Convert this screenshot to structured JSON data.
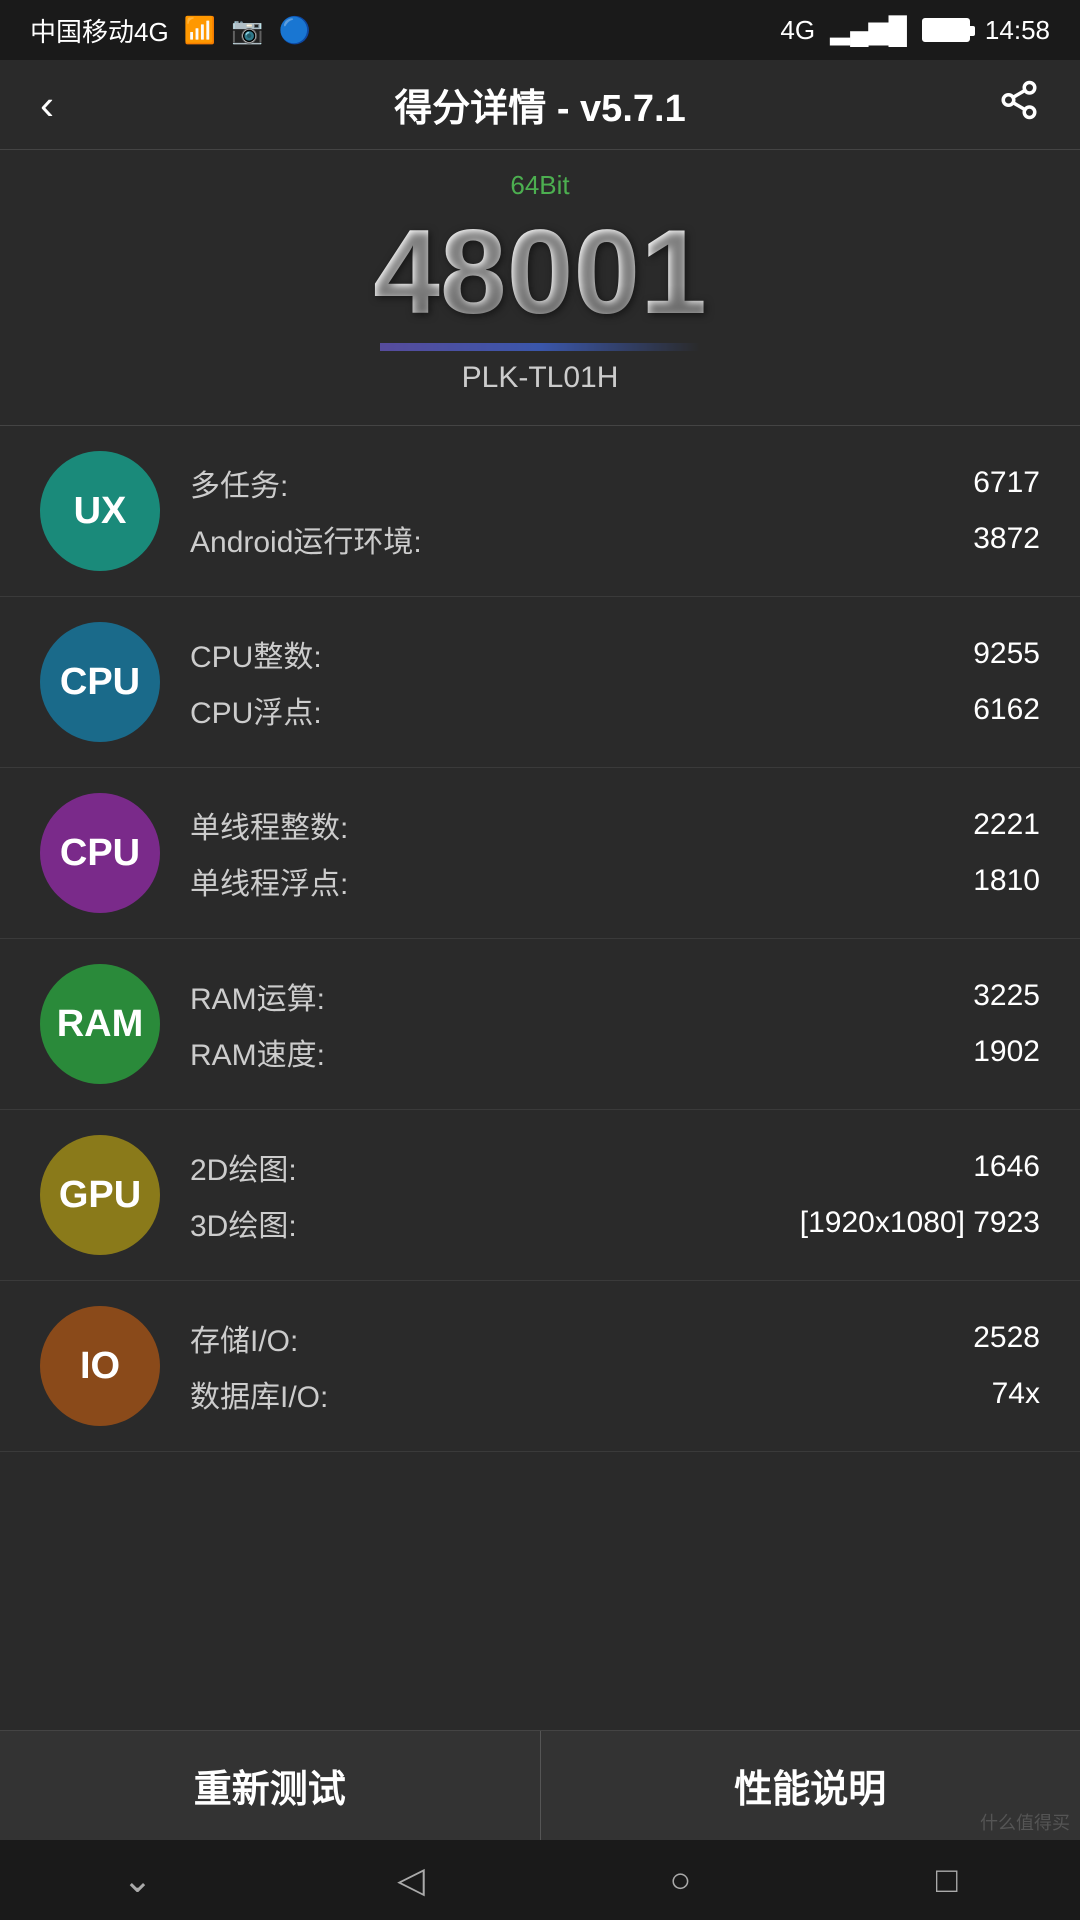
{
  "statusBar": {
    "carrier": "中国移动4G",
    "signal": "4G",
    "time": "14:58"
  },
  "header": {
    "title": "得分详情 - v5.7.1",
    "back": "‹",
    "share": "⎘"
  },
  "score": {
    "bit": "64Bit",
    "number": "48001",
    "device": "PLK-TL01H"
  },
  "benchmarks": [
    {
      "icon": "UX",
      "iconClass": "ux",
      "metrics": [
        {
          "label": "多任务:",
          "value": "6717"
        },
        {
          "label": "Android运行环境:",
          "value": "3872"
        }
      ]
    },
    {
      "icon": "CPU",
      "iconClass": "cpu-multi",
      "metrics": [
        {
          "label": "CPU整数:",
          "value": "9255"
        },
        {
          "label": "CPU浮点:",
          "value": "6162"
        }
      ]
    },
    {
      "icon": "CPU",
      "iconClass": "cpu-single",
      "metrics": [
        {
          "label": "单线程整数:",
          "value": "2221"
        },
        {
          "label": "单线程浮点:",
          "value": "1810"
        }
      ]
    },
    {
      "icon": "RAM",
      "iconClass": "ram",
      "metrics": [
        {
          "label": "RAM运算:",
          "value": "3225"
        },
        {
          "label": "RAM速度:",
          "value": "1902"
        }
      ]
    },
    {
      "icon": "GPU",
      "iconClass": "gpu",
      "metrics": [
        {
          "label": "2D绘图:",
          "value": "1646"
        },
        {
          "label": "3D绘图:",
          "value": "[1920x1080] 7923"
        }
      ]
    },
    {
      "icon": "IO",
      "iconClass": "io",
      "metrics": [
        {
          "label": "存储I/O:",
          "value": "2528"
        },
        {
          "label": "数据库I/O:",
          "value": "74x"
        }
      ]
    }
  ],
  "buttons": {
    "retest": "重新测试",
    "info": "性能说明"
  },
  "nav": {
    "down": "⌄",
    "back": "◁",
    "home": "○",
    "recent": "□"
  },
  "watermark": "什么值得买"
}
